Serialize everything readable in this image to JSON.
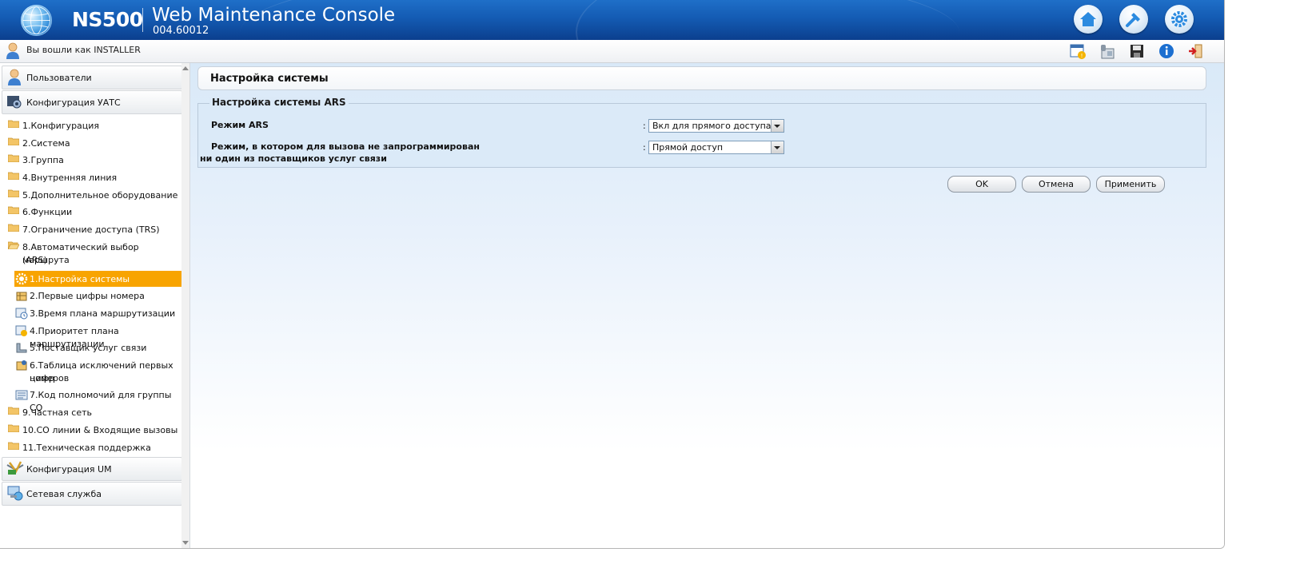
{
  "header": {
    "brand": "NS500",
    "console_title": "Web Maintenance Console",
    "version": "004.60012",
    "buttons": [
      {
        "icon": "home-icon"
      },
      {
        "icon": "wrench-icon"
      },
      {
        "icon": "gear-icon"
      }
    ]
  },
  "login": {
    "text": "Вы вошли как INSTALLER",
    "tools": [
      "calendar-alert-icon",
      "phone-icon",
      "save-icon",
      "info-icon",
      "logout-icon"
    ]
  },
  "sidebar": {
    "sections": [
      {
        "label": "Пользователи",
        "icon": "user-icon"
      },
      {
        "label": "Конфигурация УАТС",
        "icon": "pbx-config-icon"
      },
      {
        "label": "Конфигурация UM",
        "icon": "um-config-icon"
      },
      {
        "label": "Сетевая служба",
        "icon": "network-icon"
      }
    ],
    "tree": [
      {
        "label": "1.Конфигурация"
      },
      {
        "label": "2.Система"
      },
      {
        "label": "3.Группа"
      },
      {
        "label": "4.Внутренняя линия"
      },
      {
        "label": "5.Дополнительное оборудование"
      },
      {
        "label": "6.Функции"
      },
      {
        "label": "7.Ограничение доступа (TRS)"
      },
      {
        "label_line1": "8.Автоматический выбор маршрута",
        "label_line2": "(ARS)"
      },
      {
        "label": "9.Частная сеть"
      },
      {
        "label": "10.CO линии & Входящие вызовы"
      },
      {
        "label": "11.Техническая поддержка"
      }
    ],
    "ars_children": [
      {
        "label": "1.Настройка системы",
        "active": true
      },
      {
        "label": "2.Первые цифры номера"
      },
      {
        "label": "3.Время плана маршрутизации"
      },
      {
        "label": "4.Приоритет плана маршрутизации"
      },
      {
        "label": "5.Поставщик услуг связи"
      },
      {
        "label_line1": "6.Таблица исключений первых цифр",
        "label_line2": "номеров"
      },
      {
        "label": "7.Код полномочий для группы CO"
      }
    ]
  },
  "main": {
    "page_title": "Настройка системы",
    "group_title": "Настройка системы ARS",
    "fields": [
      {
        "label": "Режим ARS",
        "value": "Вкл для прямого доступа"
      },
      {
        "label_line1": "Режим, в котором для вызова не запрограммирован",
        "label_line2": "ни один из поставщиков услуг связи",
        "value": "Прямой доступ"
      }
    ],
    "buttons": {
      "ok": "OK",
      "cancel": "Отмена",
      "apply": "Применить"
    }
  },
  "colors": {
    "header_blue": "#145bb3",
    "active_item": "#f8a400"
  }
}
